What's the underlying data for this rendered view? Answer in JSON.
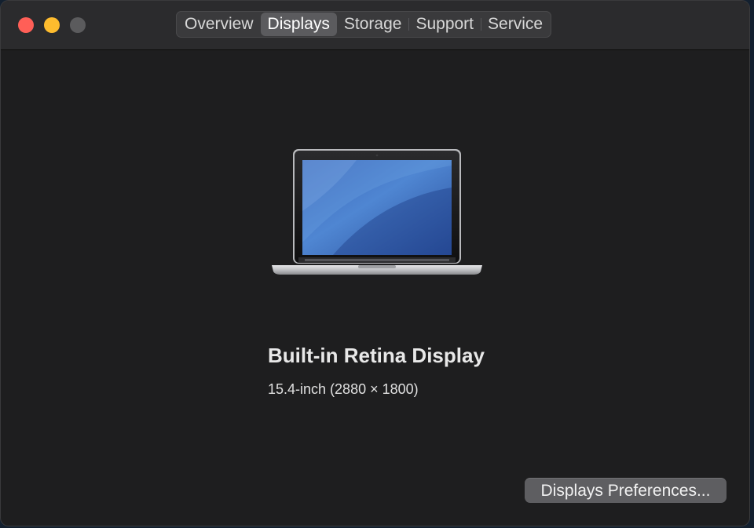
{
  "titlebar": {
    "tabs": [
      {
        "label": "Overview"
      },
      {
        "label": "Displays"
      },
      {
        "label": "Storage"
      },
      {
        "label": "Support"
      },
      {
        "label": "Service"
      }
    ],
    "active_tab": "Displays"
  },
  "display": {
    "name": "Built-in Retina Display",
    "spec": "15.4-inch (2880 × 1800)",
    "icon": "laptop-icon"
  },
  "actions": {
    "preferences_label": "Displays Preferences..."
  },
  "colors": {
    "window_bg": "#1e1e1f",
    "titlebar_bg": "#2b2b2d",
    "close": "#ff5f57",
    "minimize": "#febc2e",
    "zoom_disabled": "#5b5b5d",
    "active_tab_bg": "#5b5b5e"
  }
}
